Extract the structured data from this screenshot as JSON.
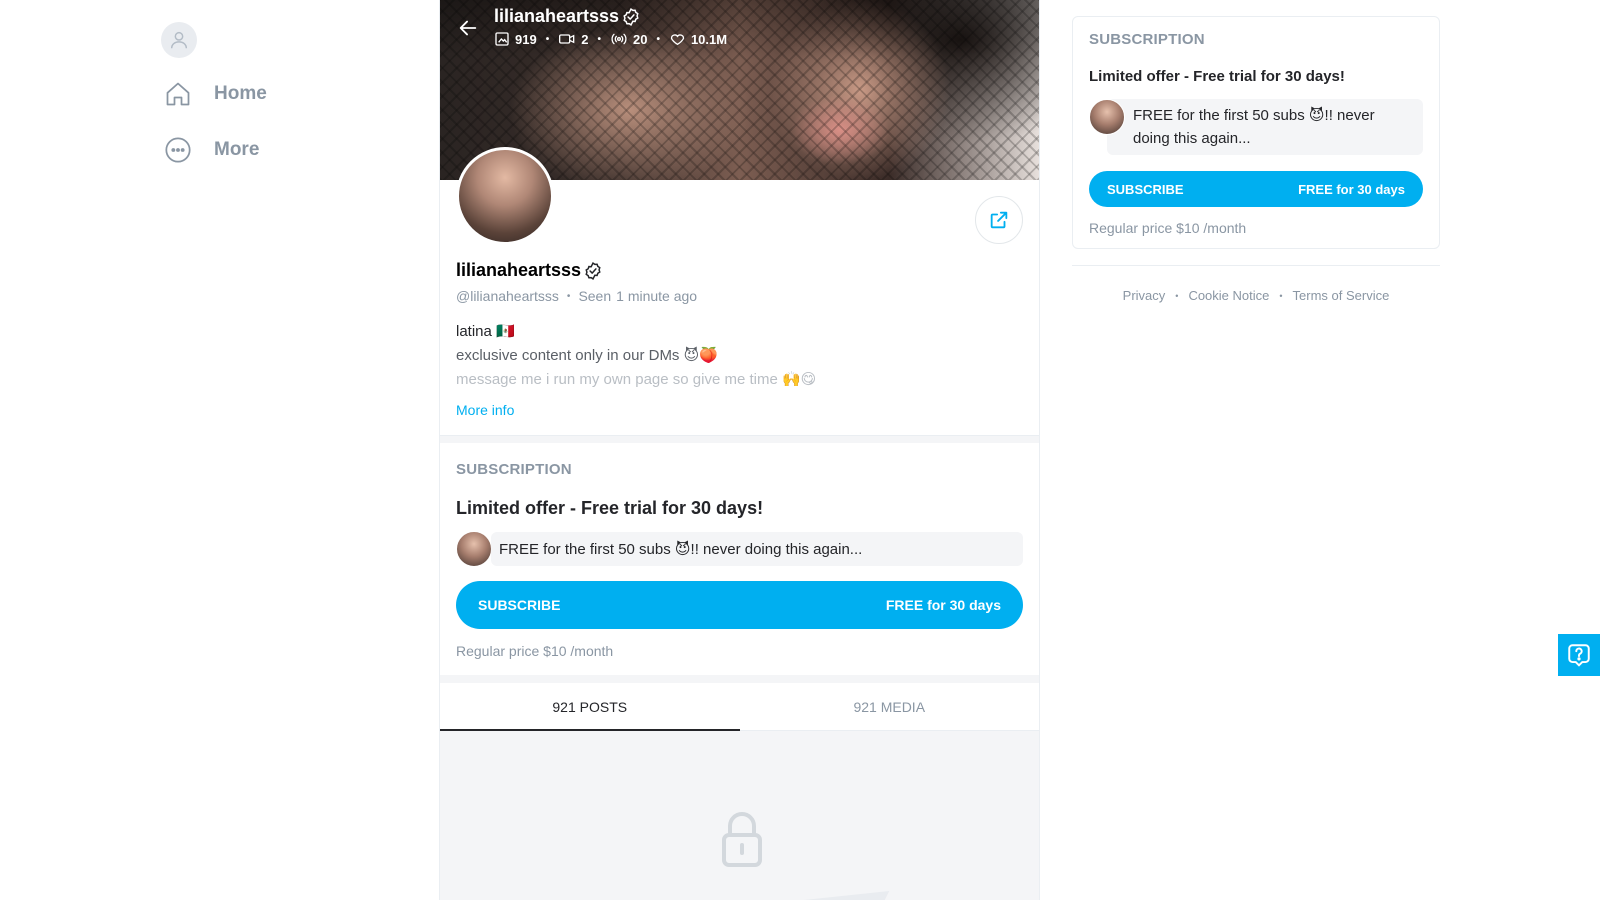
{
  "sidebar": {
    "avatar_icon": "user-icon",
    "items": [
      {
        "label": "Home",
        "icon": "home-icon"
      },
      {
        "label": "More",
        "icon": "more-circle-icon"
      }
    ]
  },
  "profile": {
    "display_name": "lilianaheartsss",
    "handle": "@lilianaheartsss",
    "seen_label": "Seen",
    "seen_time": "1 minute ago",
    "stats": {
      "photos": "919",
      "videos": "2",
      "streams": "20",
      "likes": "10.1M"
    },
    "bio": [
      "latina 🇲🇽",
      "exclusive content only in our DMs 😈🍑",
      "message me i run my own page so give me time 🙌😋"
    ],
    "more_info": "More info"
  },
  "subscription": {
    "heading": "SUBSCRIPTION",
    "offer_title": "Limited offer - Free trial for 30 days!",
    "message": "FREE for the first 50 subs 😈!! never doing this again...",
    "button_label": "SUBSCRIBE",
    "button_value": "FREE for 30 days",
    "regular_price": "Regular price $10 /month"
  },
  "tabs": [
    {
      "label": "921 POSTS",
      "active": true
    },
    {
      "label": "921 MEDIA",
      "active": false
    }
  ],
  "footer": {
    "links": [
      "Privacy",
      "Cookie Notice",
      "Terms of Service"
    ]
  },
  "colors": {
    "accent": "#00aff0",
    "muted_text": "#8a96a3",
    "text": "#242529"
  }
}
